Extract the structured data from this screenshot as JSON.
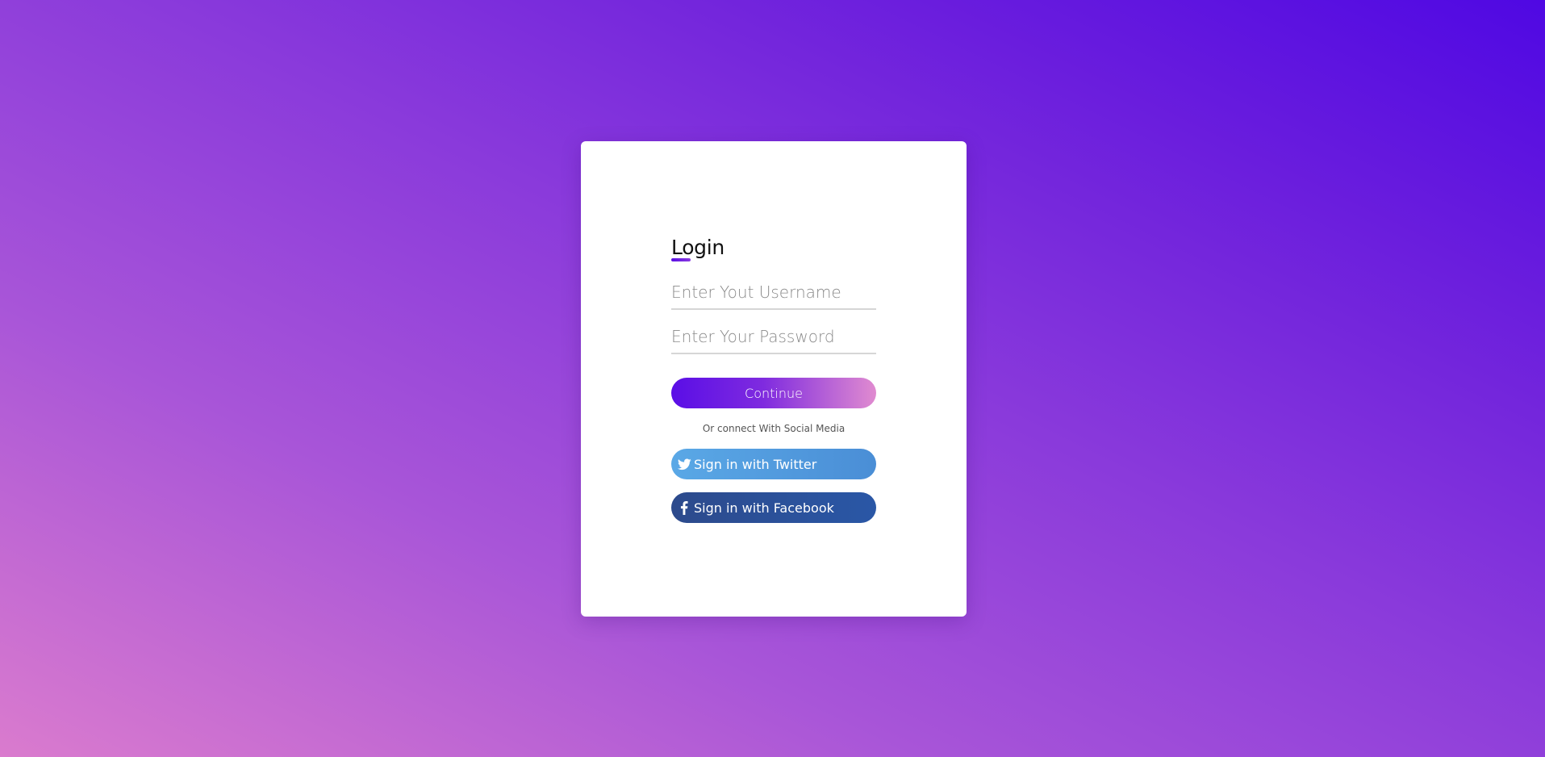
{
  "login": {
    "title": "Login",
    "username": {
      "placeholder": "Enter Yout Username",
      "value": ""
    },
    "password": {
      "placeholder": "Enter Your Password",
      "value": ""
    },
    "continue_label": "Continue",
    "social_text": "Or connect With Social Media",
    "twitter": {
      "label": "Sign in with Twitter",
      "icon": "twitter-icon"
    },
    "facebook": {
      "label": "Sign in with Facebook",
      "icon": "facebook-icon"
    }
  },
  "colors": {
    "accent_start": "#5a0ee6",
    "accent_end": "#e08bd0",
    "twitter": "#4a9be0",
    "facebook": "#2a4f98",
    "background_dark": "#4f08e3",
    "background_light": "#da7bce"
  }
}
